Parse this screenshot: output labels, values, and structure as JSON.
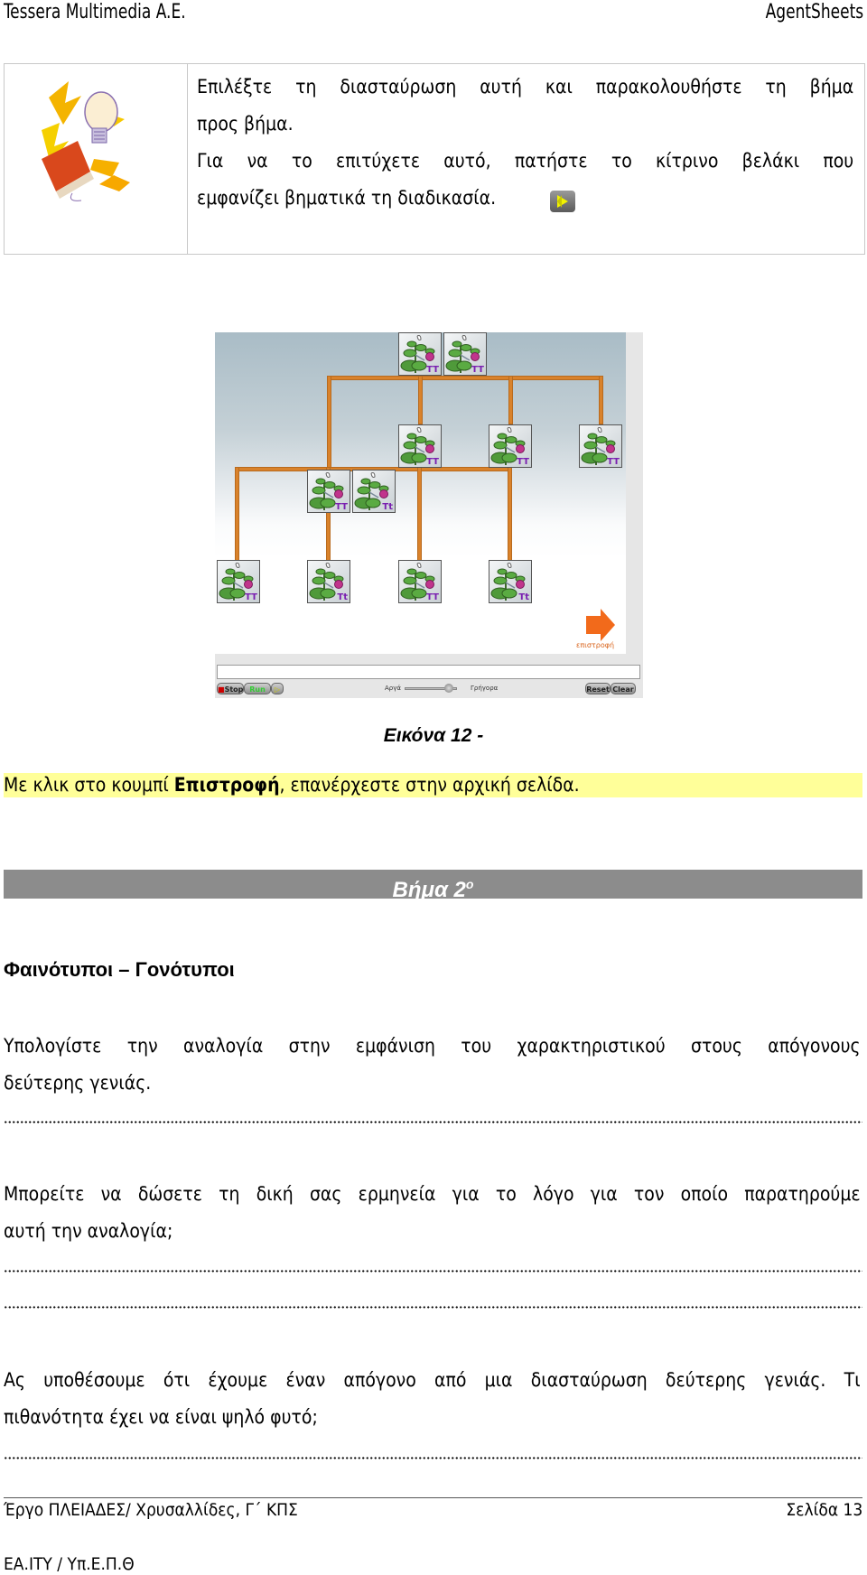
{
  "header": {
    "left": "Tessera Multimedia A.E.",
    "right": "AgentSheets"
  },
  "tip_box": {
    "icon": "idea-book-lightbulb-icon",
    "lines": [
      "Επιλέξτε τη διασταύρωση αυτή και παρακολουθήστε τη βήμα",
      "προς βήμα.",
      "Για να το επιτύχετε αυτό, πατήστε το κίτρινο βελάκι που",
      "εμφανίζει βηματικά τη διαδικασία."
    ],
    "inline_icon": "yellow-step-arrow-button-icon"
  },
  "simulation": {
    "parents_gen1": [
      {
        "genotype": "TT"
      },
      {
        "genotype": "TT"
      }
    ],
    "offspring_gen1": [
      {
        "genotype": "TT"
      },
      {
        "genotype": "TT"
      },
      {
        "genotype": "TT"
      }
    ],
    "parents_gen2": [
      {
        "genotype": "TT"
      },
      {
        "genotype": "Tt"
      }
    ],
    "offspring_gen2": [
      {
        "genotype": "TT"
      },
      {
        "genotype": "Tt"
      },
      {
        "genotype": "TT"
      },
      {
        "genotype": "Tt"
      }
    ],
    "return_button_label": "επιστροφή",
    "message_field_value": "",
    "controls": {
      "stop": "Stop",
      "run": "Run",
      "step": "▷",
      "speed_slow": "Αργά",
      "speed_fast": "Γρήγορα",
      "speed_value_percent": 85,
      "reset": "Reset",
      "clear": "Clear"
    },
    "colors": {
      "connector": "#d9822b",
      "genotype_text": "#7a1fb0",
      "return_arrow": "#f26a1b"
    }
  },
  "figure_caption": "Εικόνα 12 -",
  "highlight": {
    "prefix": "Με κλικ στο κουμπί ",
    "bold": "Επιστροφή",
    "suffix": ", επανέρχεστε στην αρχική σελίδα.",
    "color": "#ffff99"
  },
  "step_bar": {
    "label": "Βήμα 2",
    "superscript": "ο",
    "color": "#8c8c8c"
  },
  "section_heading": "Φαινότυποι – Γονότυποι",
  "questions": [
    {
      "lines": [
        "Υπολογίστε την αναλογία στην εμφάνιση του χαρακτηριστικού στους απόγονους",
        "δεύτερης γενιάς."
      ],
      "answer_lines": 1
    },
    {
      "lines": [
        "Μπορείτε να δώσετε τη δική σας ερμηνεία για το λόγο για τον οποίο παρατηρούμε",
        "αυτή την αναλογία;"
      ],
      "answer_lines": 2
    },
    {
      "lines": [
        "Ας υποθέσουμε ότι έχουμε έναν απόγονο από μια διασταύρωση δεύτερης γενιάς. Τι",
        "πιθανότητα έχει να είναι ψηλό φυτό;"
      ],
      "answer_lines": 1
    }
  ],
  "footer": {
    "left": "Έργο ΠΛΕΙΑΔΕΣ/ Χρυσαλλίδες, Γ΄ ΚΠΣ",
    "right": "Σελίδα 13",
    "bottom": "ΕΑ.ΙΤΥ / Υπ.Ε.Π.Θ"
  }
}
